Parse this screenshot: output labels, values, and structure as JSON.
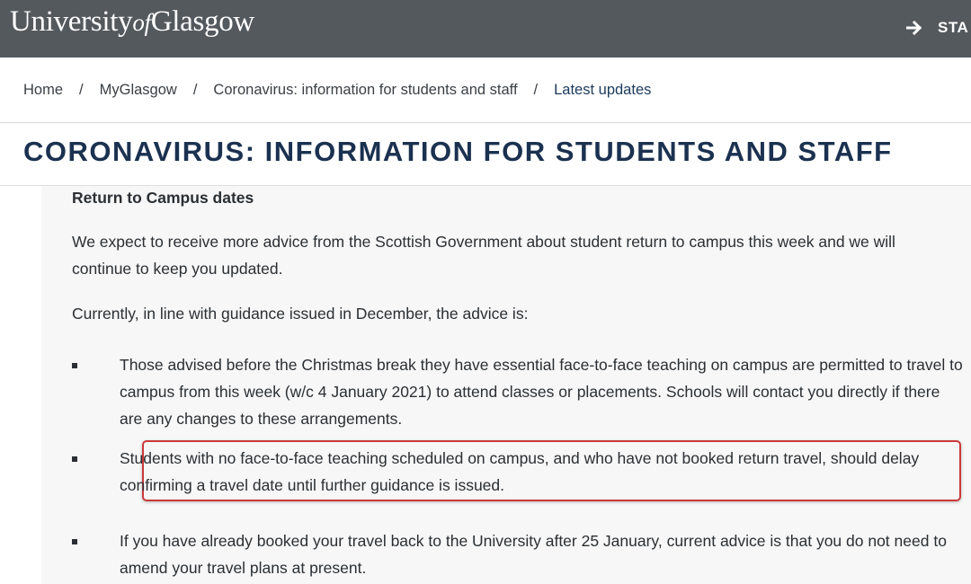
{
  "header": {
    "logo_main": "University",
    "logo_of": "of",
    "logo_end": "Glasgow",
    "start_label": "STA",
    "background_color": "#54595e"
  },
  "breadcrumb": {
    "items": [
      "Home",
      "MyGlasgow",
      "Coronavirus: information for students and staff"
    ],
    "separator": "/",
    "current": "Latest updates"
  },
  "page": {
    "title": "CORONAVIRUS: INFORMATION FOR STUDENTS AND STAFF",
    "title_color": "#1b3150"
  },
  "content": {
    "heading": "Return to Campus dates",
    "paragraph_1": "We expect to receive more advice from the Scottish Government about student return to campus this week and we will continue to keep you updated.",
    "paragraph_2": "Currently, in line with guidance issued in December, the advice is:",
    "bullets": [
      "Those advised before the Christmas break they have essential face-to-face teaching on campus are permitted to travel to campus from this week (w/c 4 January 2021) to attend classes or placements. Schools will contact you directly if there are any changes to these arrangements.",
      "Students with no face-to-face teaching scheduled on campus, and who have not booked return travel, should delay confirming a travel date until further guidance is issued.",
      "If you have already booked your travel back to the University after 25 January, current advice is that you do not need to amend your travel plans at present."
    ],
    "highlight_color": "#c93a3a"
  }
}
